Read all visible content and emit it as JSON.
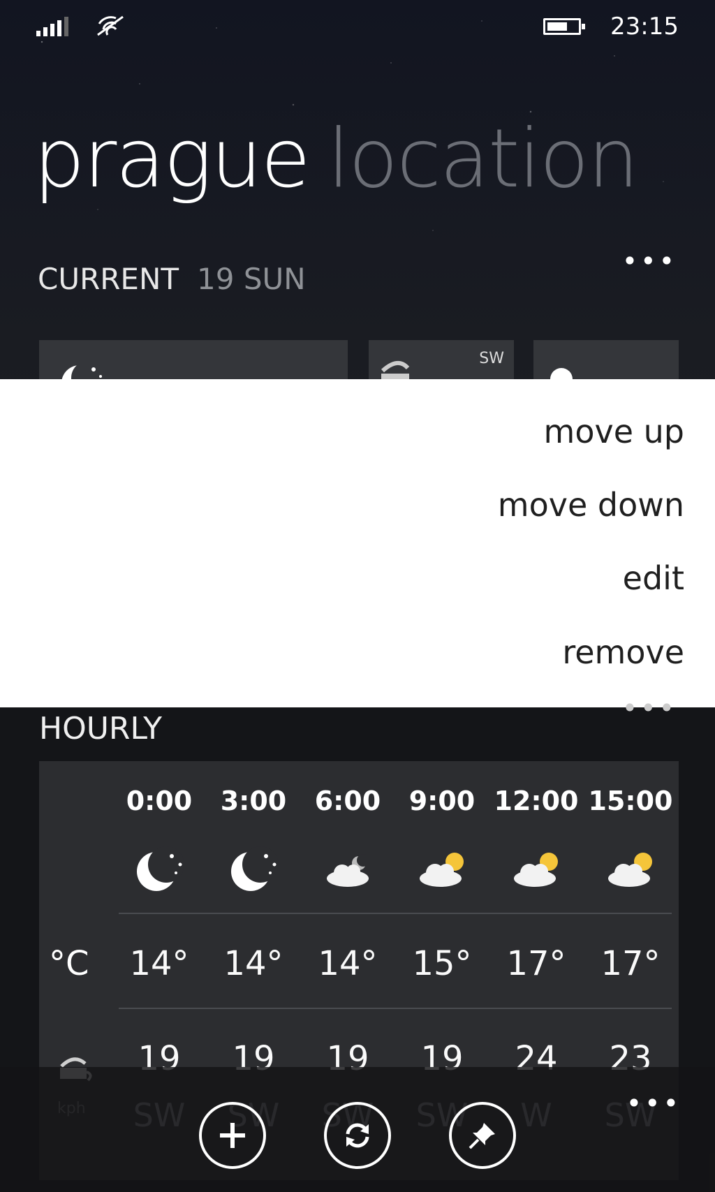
{
  "status_bar": {
    "time": "23:15"
  },
  "pivot": {
    "active": "prague",
    "inactive": "location"
  },
  "current": {
    "label": "CURRENT",
    "date": "19 SUN",
    "wind_direction": "SW"
  },
  "context_menu": [
    "move up",
    "move down",
    "edit",
    "remove"
  ],
  "hourly": {
    "label": "HOURLY",
    "temp_unit": "°C",
    "wind_unit": "kph",
    "times": [
      "0:00",
      "3:00",
      "6:00",
      "9:00",
      "12:00",
      "15:00"
    ],
    "icons": [
      "clear-night-icon",
      "clear-night-icon",
      "partly-cloudy-night-icon",
      "partly-cloudy-day-icon",
      "partly-cloudy-day-icon",
      "partly-cloudy-day-icon"
    ],
    "temperatures": [
      "14°",
      "14°",
      "14°",
      "15°",
      "17°",
      "17°"
    ],
    "wind_speeds": [
      "19",
      "19",
      "19",
      "19",
      "24",
      "23"
    ],
    "wind_directions": [
      "SW",
      "SW",
      "SW",
      "SW",
      "W",
      "SW"
    ]
  },
  "app_bar": {
    "buttons": [
      "add-icon",
      "refresh-icon",
      "pin-icon"
    ]
  },
  "colors": {
    "background": "#141518",
    "panel": "#2c2d30",
    "sun": "#f5c53a"
  }
}
